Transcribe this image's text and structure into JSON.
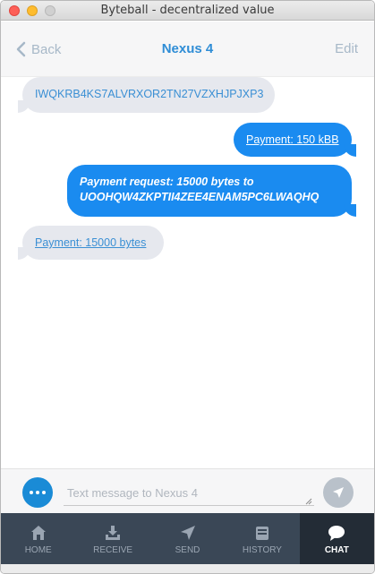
{
  "window": {
    "title": "Byteball - decentralized value"
  },
  "header": {
    "back_label": "Back",
    "title": "Nexus 4",
    "edit_label": "Edit"
  },
  "messages": [
    {
      "direction": "in",
      "text": "IWQKRB4KS7ALVRXOR2TN27VZXHJPJXP3",
      "is_link": false
    },
    {
      "direction": "out",
      "text": "Payment: 150 kBB",
      "is_link": true
    },
    {
      "direction": "out",
      "text_line1": "Payment request: 15000 bytes to",
      "text_line2": "UOOHQW4ZKPTII4ZEE4ENAM5PC6LWAQHQ"
    },
    {
      "direction": "in",
      "text": "Payment: 15000 bytes",
      "is_link": true
    }
  ],
  "composer": {
    "placeholder": "Text message to Nexus 4",
    "value": ""
  },
  "tabs": [
    {
      "label": "HOME",
      "icon": "home-icon",
      "active": false
    },
    {
      "label": "RECEIVE",
      "icon": "download-icon",
      "active": false
    },
    {
      "label": "SEND",
      "icon": "paper-plane-icon",
      "active": false
    },
    {
      "label": "HISTORY",
      "icon": "history-box-icon",
      "active": false
    },
    {
      "label": "CHAT",
      "icon": "chat-bubble-icon",
      "active": true
    }
  ],
  "colors": {
    "accent": "#1a8bf0",
    "header_title": "#2f8dd6",
    "incoming_bubble": "#e6e8ee",
    "tabbar": "#3a4756",
    "tab_active": "#232c36"
  }
}
